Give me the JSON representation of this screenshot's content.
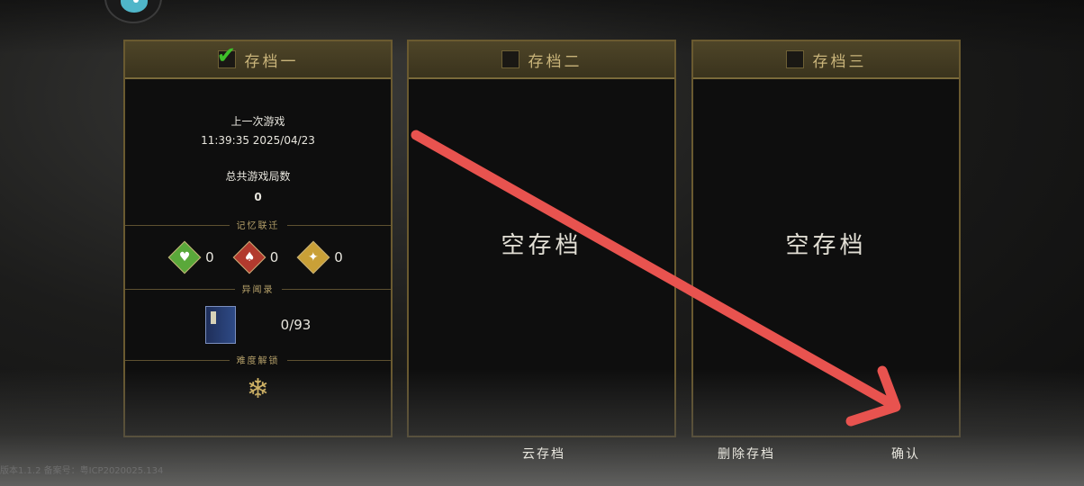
{
  "slots": [
    {
      "title": "存档一",
      "checked": true,
      "last_game_label": "上一次游戏",
      "last_game_time": "11:39:35 2025/04/23",
      "total_games_label": "总共游戏局数",
      "total_games_value": "0",
      "memory_section_label": "记忆联迁",
      "gems": [
        {
          "icon": "green-heart-gem-icon",
          "color": "#5aa83a",
          "value": "0"
        },
        {
          "icon": "red-gem-icon",
          "color": "#b23a2e",
          "value": "0"
        },
        {
          "icon": "gold-gem-icon",
          "color": "#c9a037",
          "value": "0"
        }
      ],
      "records_section_label": "异闻录",
      "records_value": "0/93",
      "difficulty_section_label": "难度解锁",
      "difficulty_icon": "snowflake-icon"
    },
    {
      "title": "存档二",
      "checked": false,
      "empty_label": "空存档"
    },
    {
      "title": "存档三",
      "checked": false,
      "empty_label": "空存档"
    }
  ],
  "buttons": {
    "cloud_save": "云存档",
    "delete_save": "删除存档",
    "confirm": "确认"
  },
  "version_text": "版本1.1.2  备案号：粤ICP2020025.134",
  "annotation": {
    "color": "#e8534f"
  }
}
